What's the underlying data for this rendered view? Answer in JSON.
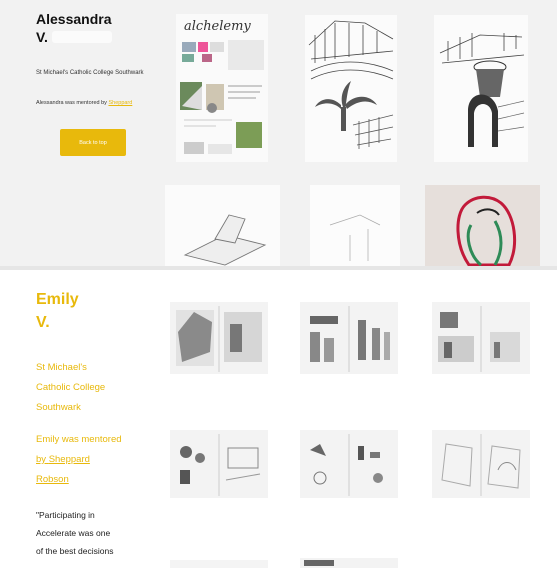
{
  "alessandra": {
    "first_name": "Alessandra",
    "last_initial": "V.",
    "school": "St Michael's Catholic College Southwark",
    "mentor_prefix": "Alessandra was mentored by",
    "mentor_name": "Sheppard",
    "button_label": "Back to top",
    "thumb1_title": "alchelemy"
  },
  "emily": {
    "first_name": "Emily",
    "last_initial": "V.",
    "school_line1": "St Michael's",
    "school_line2": "Catholic College",
    "school_line3": "Southwark",
    "mentor_line1": "Emily was mentored",
    "mentor_by": "by",
    "mentor_name1": "Sheppard",
    "mentor_name2": "Robson",
    "quote_line1": "\"Participating in",
    "quote_line2": "Accelerate was one",
    "quote_line3": "of the best decisions"
  },
  "colors": {
    "accent": "#e8b90c",
    "card_bg": "#f2f2f2",
    "text": "#111111"
  }
}
